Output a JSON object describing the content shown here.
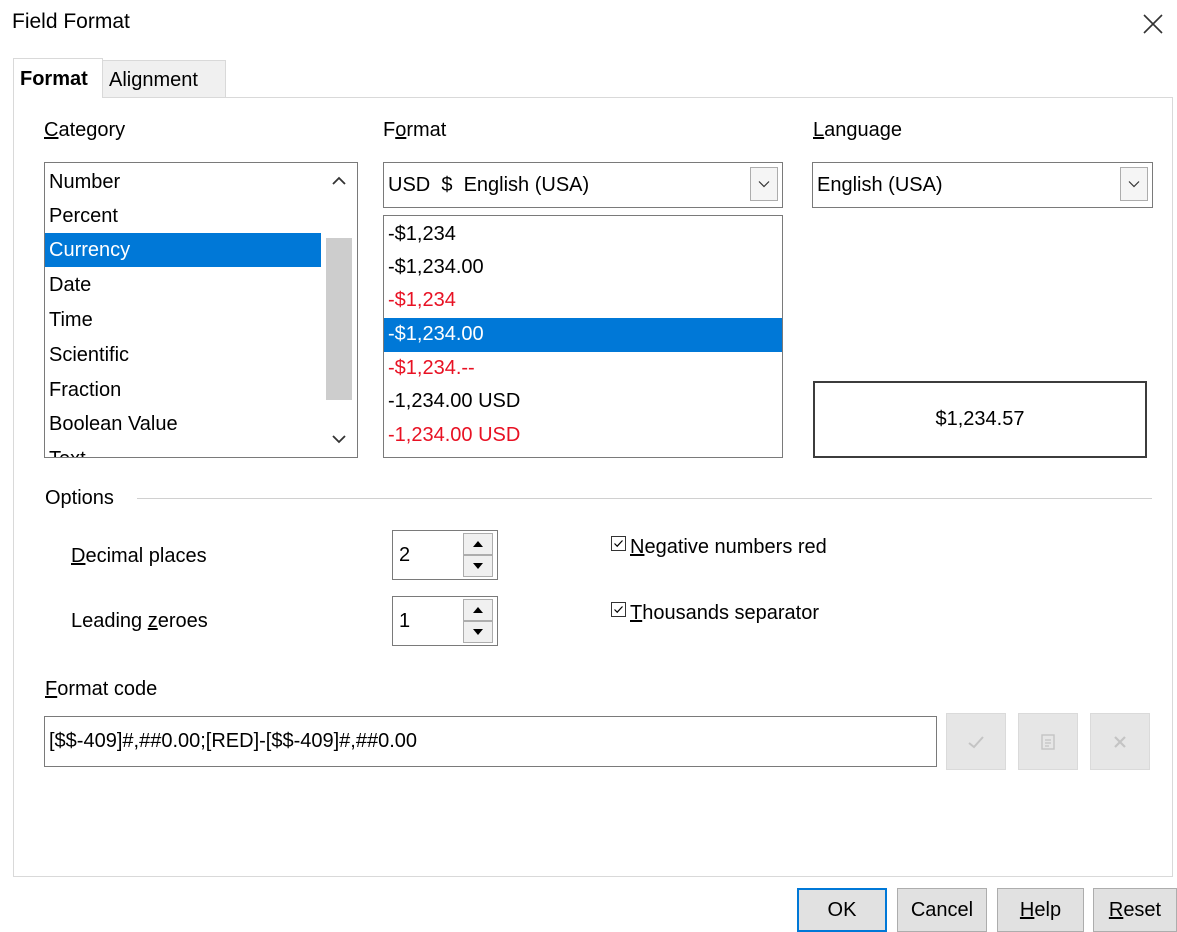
{
  "window": {
    "title": "Field Format",
    "close_icon": "close-icon"
  },
  "tabs": [
    {
      "label": "Format",
      "active": true
    },
    {
      "label": "Alignment",
      "active": false
    }
  ],
  "category": {
    "label_mnemonic": "C",
    "label_rest": "ategory",
    "items": [
      "Number",
      "Percent",
      "Currency",
      "Date",
      "Time",
      "Scientific",
      "Fraction",
      "Boolean Value",
      "Text"
    ],
    "selected": "Currency"
  },
  "format": {
    "label_before": "F",
    "label_mnemonic": "o",
    "label_rest": "rmat",
    "combo_value": "USD  $  English (USA)",
    "items": [
      {
        "text": "-$1,234",
        "red": false
      },
      {
        "text": "-$1,234.00",
        "red": false
      },
      {
        "text": "-$1,234",
        "red": true
      },
      {
        "text": "-$1,234.00",
        "red": false,
        "selected": true
      },
      {
        "text": "-$1,234.--",
        "red": true
      },
      {
        "text": "-1,234.00 USD",
        "red": false
      },
      {
        "text": "-1,234.00 USD",
        "red": true
      }
    ]
  },
  "language": {
    "label_mnemonic": "L",
    "label_rest": "anguage",
    "combo_value": "English (USA)"
  },
  "preview": {
    "value": "$1,234.57"
  },
  "options": {
    "label": "Options",
    "decimal_places": {
      "label_mnemonic": "D",
      "label_rest": "ecimal places",
      "value": "2"
    },
    "leading_zeroes": {
      "label_before": "Leading ",
      "label_mnemonic": "z",
      "label_rest": "eroes",
      "value": "1"
    },
    "negative_red": {
      "label_mnemonic": "N",
      "label_rest": "egative numbers red",
      "checked": true
    },
    "thousands_separator": {
      "label_mnemonic": "T",
      "label_rest": "housands separator",
      "checked": true
    }
  },
  "format_code": {
    "label_mnemonic": "F",
    "label_rest": "ormat code",
    "value": "[$$-409]#,##0.00;[RED]-[$$-409]#,##0.00"
  },
  "buttons": {
    "ok": "OK",
    "cancel": "Cancel",
    "help_mnemonic": "H",
    "help_rest": "elp",
    "reset_mnemonic": "R",
    "reset_rest": "eset"
  },
  "colors": {
    "selection": "#0078d7",
    "negative_red": "#e81123"
  }
}
